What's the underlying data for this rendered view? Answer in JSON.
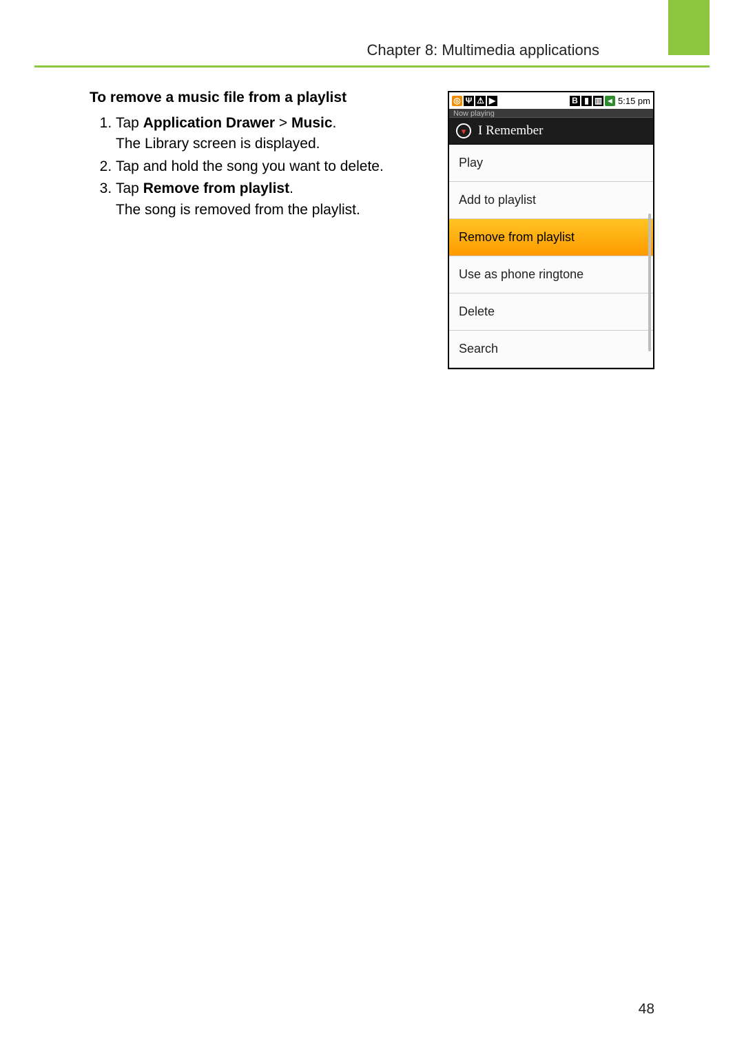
{
  "header": {
    "chapter_title": "Chapter 8: Multimedia applications"
  },
  "section": {
    "title": "To remove a music file from a playlist",
    "steps": [
      {
        "prefix": "Tap ",
        "bold1": "Application Drawer",
        "mid": " > ",
        "bold2": "Music",
        "suffix": ".",
        "result": "The Library screen is displayed."
      },
      {
        "text": "Tap and hold the song you want to delete."
      },
      {
        "prefix": "Tap ",
        "bold1": "Remove from playlist",
        "suffix": ".",
        "result": "The song is removed from the playlist."
      }
    ]
  },
  "screenshot": {
    "status_time": "5:15 pm",
    "now_playing_label": "Now playing",
    "song_title": "I Remember",
    "menu_items": [
      {
        "label": "Play",
        "highlight": false
      },
      {
        "label": "Add to playlist",
        "highlight": false
      },
      {
        "label": "Remove from playlist",
        "highlight": true
      },
      {
        "label": "Use as phone ringtone",
        "highlight": false
      },
      {
        "label": "Delete",
        "highlight": false
      },
      {
        "label": "Search",
        "highlight": false
      }
    ]
  },
  "page_number": "48"
}
